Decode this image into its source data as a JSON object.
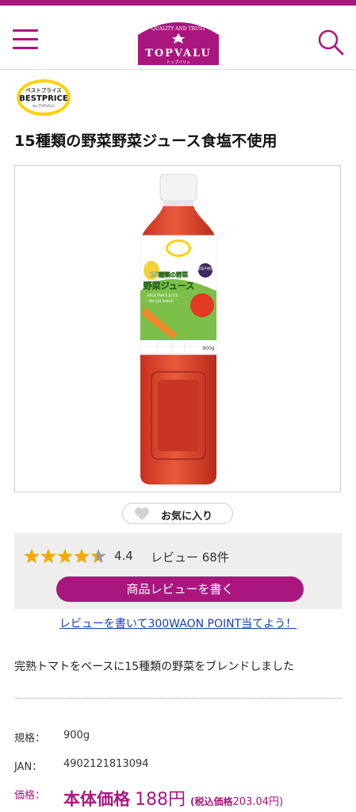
{
  "header": {
    "brand": "TOPVALU",
    "brand_tagline": "QUALITY AND TRUST",
    "brand_kana": "トップバリュ",
    "accent_color": "#a9177e"
  },
  "badge": {
    "line1": "ベストプライス",
    "line2": "BESTPRICE",
    "line3": "by TOPVALU"
  },
  "product": {
    "title": "15種類の野菜野菜ジュース食塩不使用",
    "image": {
      "bottle_line1": "15種類の野菜",
      "bottle_line2": "野菜ジュース",
      "bottle_line3": "VEGETABLE JUICE",
      "bottle_line4": "(No Salt Added)",
      "bottle_tag": "食塩不使用",
      "bottle_volume": "900g"
    }
  },
  "favorite": {
    "label": "お気に入り"
  },
  "review": {
    "rating": 4.4,
    "rating_text": "4.4",
    "count_text": "レビュー 68件",
    "write_button": "商品レビューを書く"
  },
  "campaign_link": "レビューを書いて300WAON POINT当てよう！",
  "description": "完熟トマトをベースに15種類の野菜をブレンドしました",
  "specs": {
    "size_label": "規格：",
    "size_value": "900g",
    "jan_label": "JAN：",
    "jan_value": "4902121813094"
  },
  "price": {
    "label": "価格：",
    "main_label": "本体価格",
    "main_value": "188円",
    "tax_label": "(税込価格",
    "tax_value": "203.04円)"
  }
}
